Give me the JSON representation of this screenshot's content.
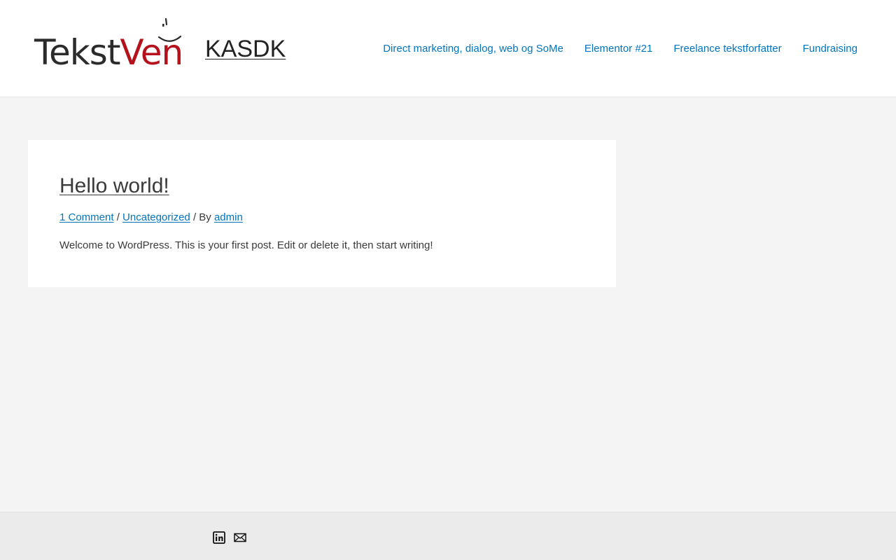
{
  "header": {
    "logo": {
      "wordmark_dark": "Tekst",
      "wordmark_red": "Ven",
      "ink_color": "#2b2b2b",
      "accent_color": "#b5121b"
    },
    "site_title": "KASDK",
    "nav": [
      {
        "label": "Direct marketing, dialog, web og SoMe"
      },
      {
        "label": "Elementor #21"
      },
      {
        "label": "Freelance tekstforfatter"
      },
      {
        "label": "Fundraising"
      }
    ]
  },
  "post": {
    "title": "Hello world!",
    "meta": {
      "comments": "1 Comment",
      "sep1": " / ",
      "category": "Uncategorized",
      "by_text": " / By ",
      "author": "admin"
    },
    "excerpt": "Welcome to WordPress. This is your first post. Edit or delete it, then start writing!"
  },
  "footer": {
    "social": [
      {
        "icon": "linkedin-icon"
      },
      {
        "icon": "email-icon"
      }
    ]
  },
  "colors": {
    "link": "#0274be",
    "text": "#3a3a3a",
    "page_background": "#f4f4f4",
    "footer_background": "#ebebeb"
  }
}
